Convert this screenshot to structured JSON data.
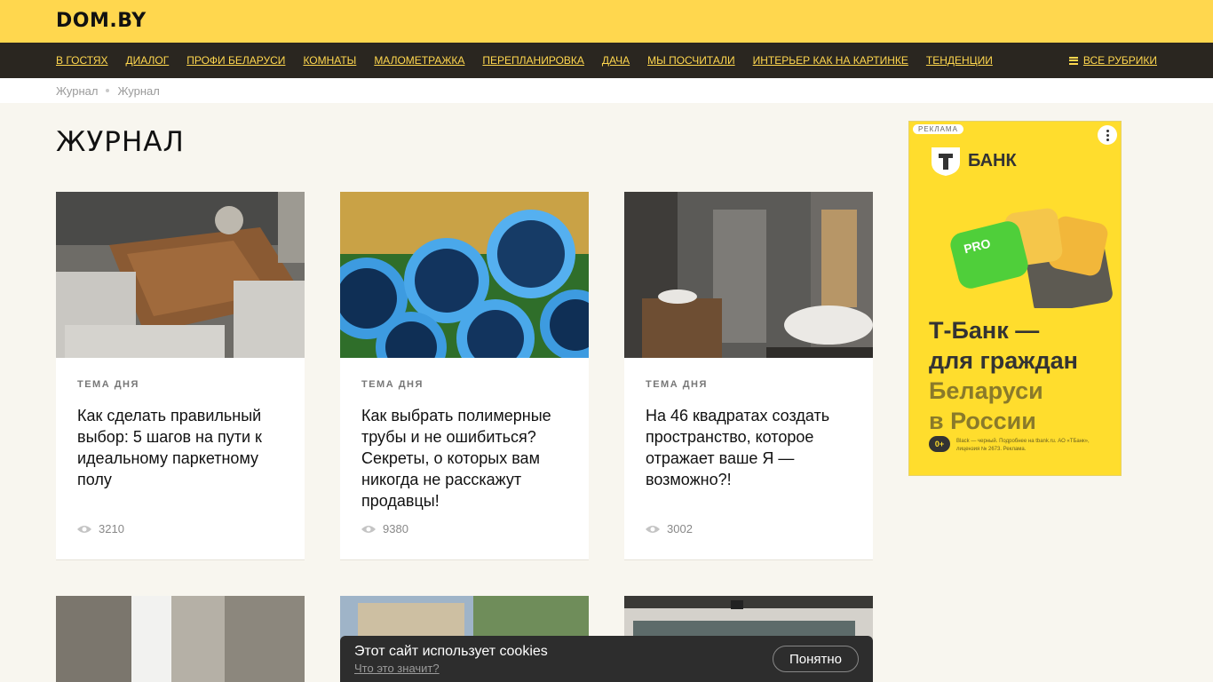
{
  "site": {
    "logo": "DOM.BY"
  },
  "nav": {
    "items": [
      {
        "label": "В ГОСТЯХ"
      },
      {
        "label": "ДИАЛОГ"
      },
      {
        "label": "ПРОФИ БЕЛАРУСИ"
      },
      {
        "label": "КОМНАТЫ"
      },
      {
        "label": "МАЛОМЕТРАЖКА"
      },
      {
        "label": "ПЕРЕПЛАНИРОВКА"
      },
      {
        "label": "ДАЧА"
      },
      {
        "label": "МЫ ПОСЧИТАЛИ"
      },
      {
        "label": "ИНТЕРЬЕР КАК НА КАРТИНКЕ"
      },
      {
        "label": "ТЕНДЕНЦИИ"
      }
    ],
    "all_rubrics": "ВСЕ РУБРИКИ",
    "accent_color": "#ffd74e"
  },
  "breadcrumbs": [
    "Журнал",
    "Журнал"
  ],
  "page": {
    "title": "ЖУРНАЛ"
  },
  "cards": [
    {
      "tag": "ТЕМА ДНЯ",
      "title": "Как сделать правильный выбор: 5 шагов на пути к идеальному паркетному полу",
      "views": "3210"
    },
    {
      "tag": "ТЕМА ДНЯ",
      "title": "Как выбрать полимерные трубы и не ошибиться? Секреты, о которых вам никогда не расскажут продавцы!",
      "views": "9380"
    },
    {
      "tag": "ТЕМА ДНЯ",
      "title": "На 46 квадратах создать пространство, которое отражает ваше Я — возможно?!",
      "views": "3002"
    }
  ],
  "ad": {
    "badge": "РЕКЛАМА",
    "brand": "БАНК",
    "headline_lines": [
      "Т-Банк —",
      "для граждан",
      "Беларуси",
      "в России"
    ],
    "age": "0+",
    "fine_print": "Black — черный. Подробнее на tbank.ru. АО «ТБанк», лицензия № 2673. Реклама."
  },
  "cookie": {
    "text": "Этот сайт использует cookies",
    "link": "Что это значит?",
    "button": "Понятно"
  }
}
